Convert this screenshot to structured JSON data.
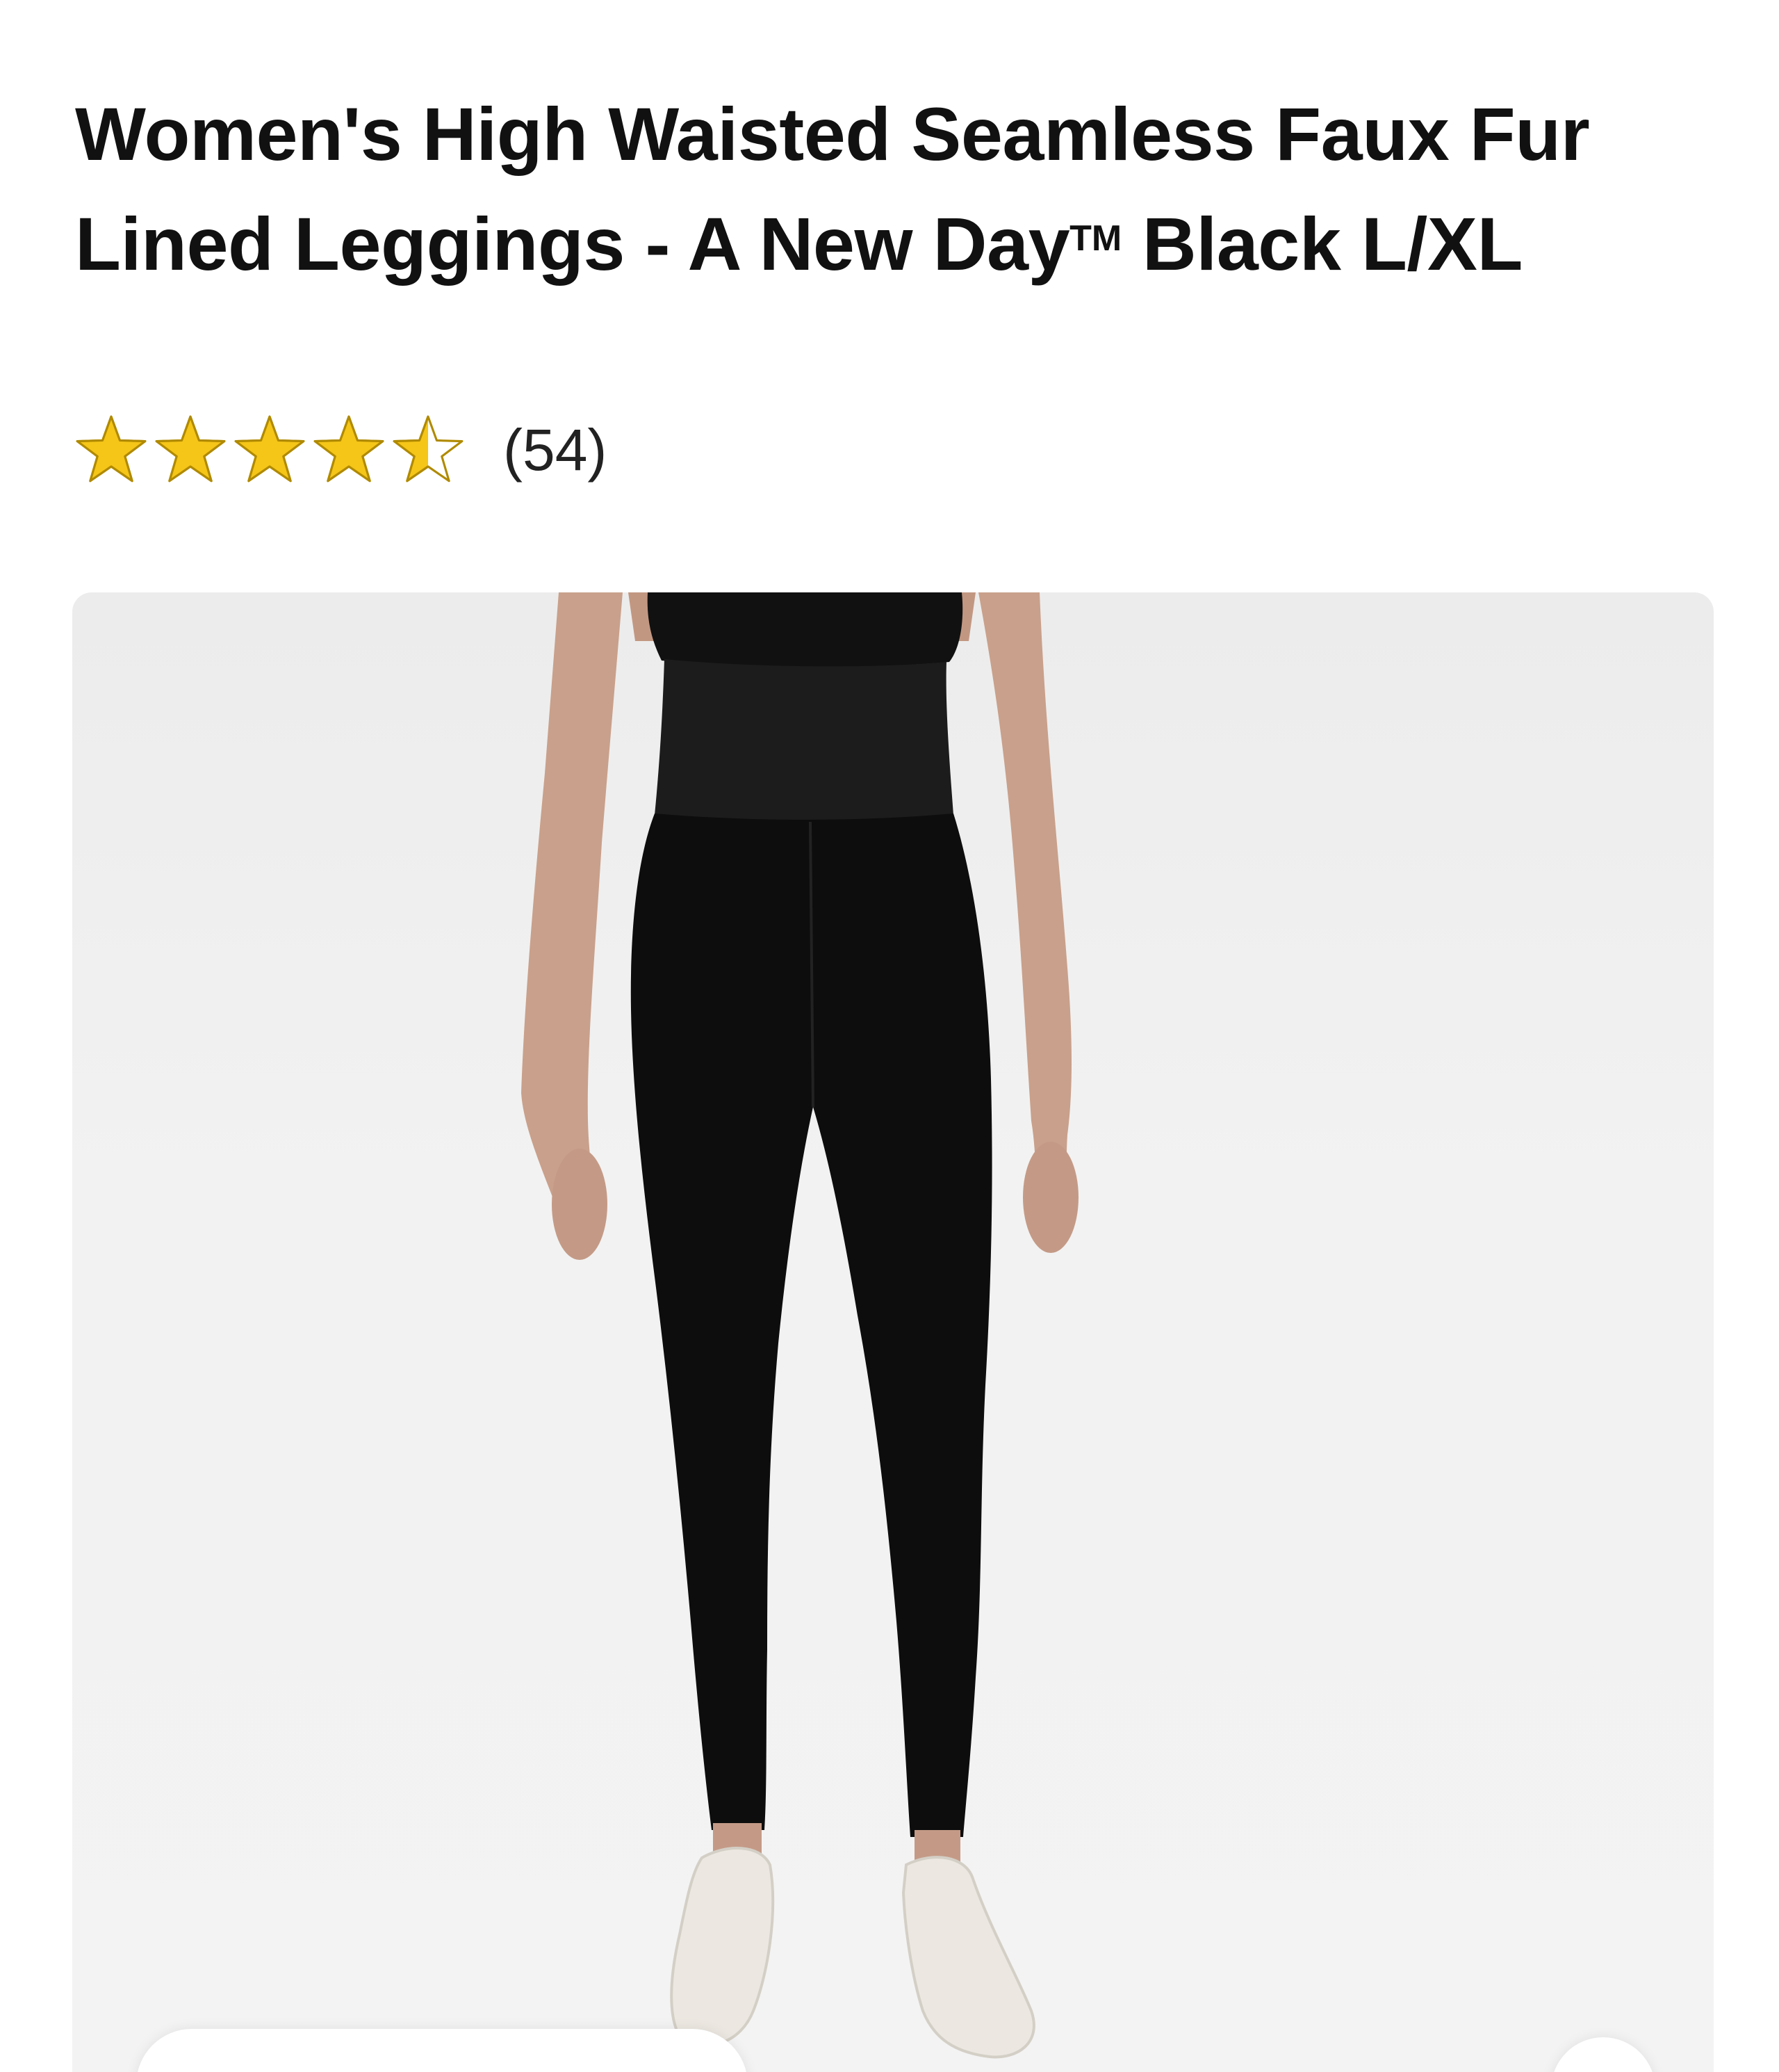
{
  "product": {
    "title_main": "Women's High Waisted Seamless Faux Fur Lined Leggings - A New Day",
    "title_trademark": "TM",
    "title_tail": " Black L/XL"
  },
  "rating": {
    "value": 4.5,
    "max": 5,
    "count_label": "(54)",
    "star_color": "#f5c518",
    "star_outline_color": "#b08a00"
  },
  "image": {
    "icon": "product-photo-leggings",
    "background_color": "#efefef",
    "garment_color": "#0d0d0d"
  }
}
